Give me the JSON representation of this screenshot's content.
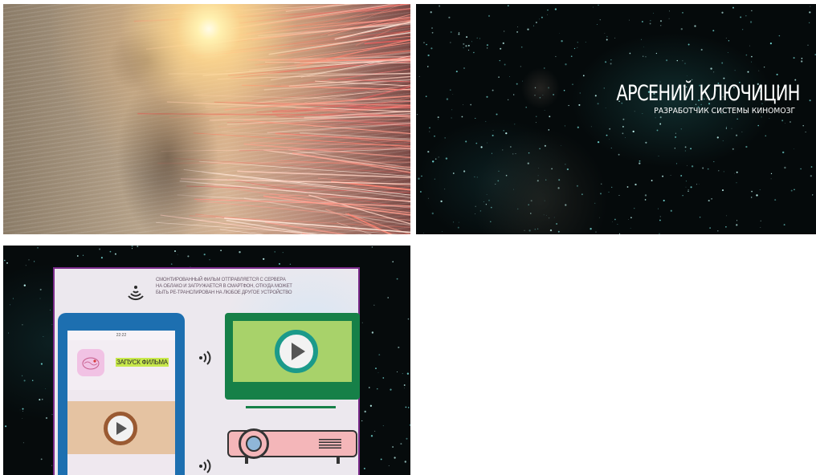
{
  "frame_1": {
    "content": "light-streak tunnel"
  },
  "frame_2": {
    "title": "АРСЕНИЙ КЛЮЧИЦИН",
    "subtitle": "РАЗРАБОТЧИК СИСТЕМЫ КИНОМОЗГ"
  },
  "frame_3": {
    "description": "СМОНТИРОВАННЫЙ ФИЛЬМ ОТПРАВЛЯЕТСЯ С СЕРВЕРА НА ОБЛАКО И ЗАГРУЖАЕТСЯ В СМАРТФОН, ОТКУДА МОЖЕТ БЫТЬ РЕ-ТРАНСЛИРОВАН НА ЛЮБОЕ ДРУГОЕ УСТРОЙСТВО",
    "phone": {
      "time": "22:22",
      "app_label": "ЗАПУСК ФИЛЬМА"
    },
    "icons": [
      "wifi-icon",
      "brain-icon",
      "play-icon",
      "signal-icon",
      "tv-icon",
      "projector-icon"
    ],
    "colors": {
      "phone": "#1d6fb0",
      "tv": "#168048",
      "tv_screen": "#a8d26a",
      "projector": "#f4b6b9",
      "label_highlight": "#c7e84b",
      "panel_border": "#7a2a8a"
    }
  }
}
